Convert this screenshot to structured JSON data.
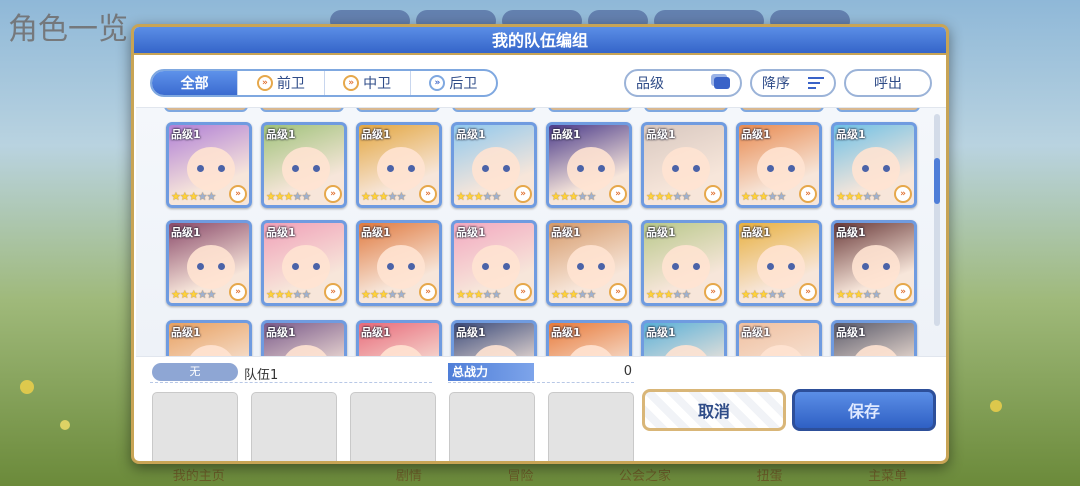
{
  "background": {
    "title": "角色一览",
    "bottom_nav": [
      "我的主页",
      "",
      "剧情",
      "冒险",
      "公会之家",
      "扭蛋",
      "主菜单"
    ]
  },
  "dialog": {
    "title": "我的队伍编组",
    "filter_tabs": [
      {
        "label": "全部",
        "active": true,
        "icon": ""
      },
      {
        "label": "前卫",
        "active": false,
        "icon": "front-position-icon"
      },
      {
        "label": "中卫",
        "active": false,
        "icon": "middle-position-icon"
      },
      {
        "label": "后卫",
        "active": false,
        "icon": "back-position-icon"
      }
    ],
    "sort_key": "品级",
    "sort_order": "降序",
    "call_label": "呼出",
    "grade_label": "品级1",
    "cards_row1": [
      {
        "stars": 3,
        "color": "#b07fd6"
      },
      {
        "stars": 3,
        "color": "#9fc27a"
      },
      {
        "stars": 3,
        "color": "#e3a640"
      },
      {
        "stars": 3,
        "color": "#8fc8ee"
      },
      {
        "stars": 3,
        "color": "#4a3a8a"
      },
      {
        "stars": 3,
        "color": "#d8c8c0"
      },
      {
        "stars": 3,
        "color": "#e88a50"
      },
      {
        "stars": 3,
        "color": "#6ec0e6"
      }
    ],
    "cards_row2": [
      {
        "stars": 3,
        "color": "#8a4a6a"
      },
      {
        "stars": 3,
        "color": "#f0a0b8"
      },
      {
        "stars": 3,
        "color": "#e07a40"
      },
      {
        "stars": 3,
        "color": "#f2a8c0"
      },
      {
        "stars": 3,
        "color": "#d69a6a"
      },
      {
        "stars": 3,
        "color": "#b8c88a"
      },
      {
        "stars": 3,
        "color": "#e8b040"
      },
      {
        "stars": 3,
        "color": "#6a3a3a"
      }
    ],
    "cards_row3": [
      {
        "color": "#e8a060"
      },
      {
        "color": "#7a5a8a"
      },
      {
        "color": "#e86a7a"
      },
      {
        "color": "#3a4a7a"
      },
      {
        "color": "#e87a3a"
      },
      {
        "color": "#5ab0d8"
      },
      {
        "color": "#f0c0a0"
      },
      {
        "color": "#5a5a6a"
      }
    ],
    "team": {
      "badge": "无",
      "name": "队伍1",
      "power_label": "总战力",
      "power_value": "0"
    },
    "cancel_label": "取消",
    "save_label": "保存",
    "accent_color": "#3b6bd0",
    "frame_color": "#c8a455"
  }
}
